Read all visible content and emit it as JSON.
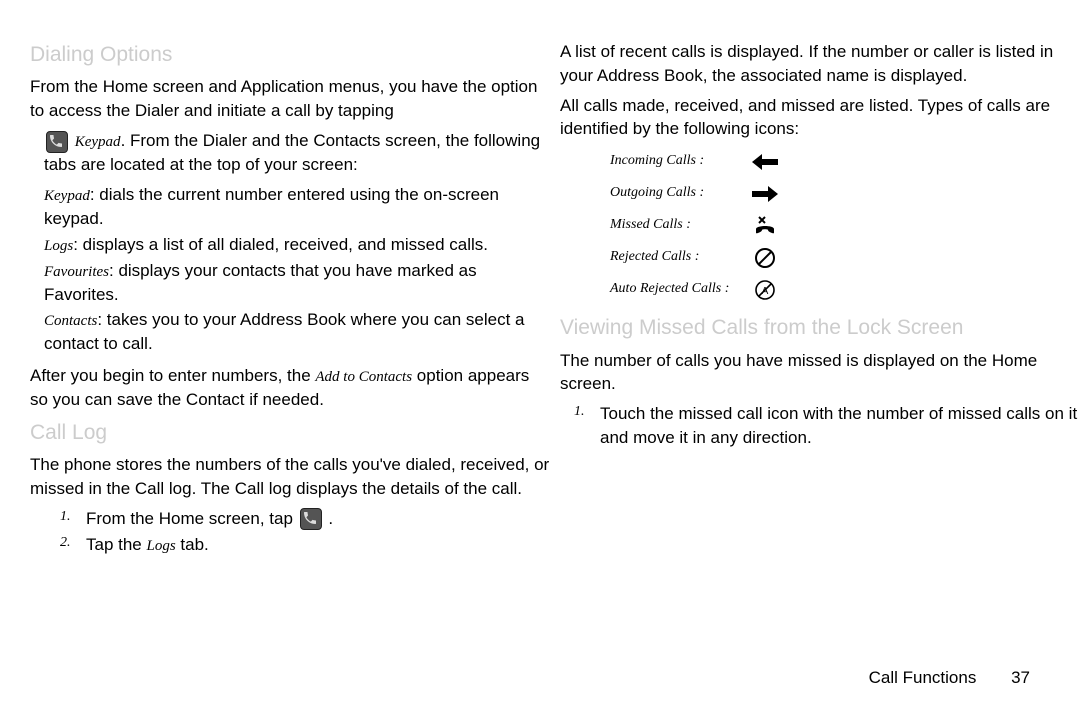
{
  "left": {
    "h1": "Dialing Options",
    "p1": "From the Home screen and Application menus, you have the option to access the Dialer and initiate a call by tapping",
    "p1b_a": "Keypad",
    "p1b_b": ". From the Dialer and the Contacts screen, the following tabs are located at the top of your screen:",
    "tabs": {
      "keypad_label": "Keypad",
      "keypad_desc": ": dials the current number entered using the on-screen keypad.",
      "logs_label": "Logs",
      "logs_desc": ": displays a list of all dialed, received, and missed calls.",
      "fav_label": "Favourites",
      "fav_desc": ": displays your contacts that you have marked as Favorites.",
      "contacts_label": "Contacts",
      "contacts_desc": ": takes you to your Address Book where you can select a contact to call."
    },
    "p2a": "After you begin to enter numbers, the ",
    "p2a_opt": "Add to Contacts",
    "p2b": " option appears so you can save the Contact if needed.",
    "h2": "Call Log",
    "p3": "The phone stores the numbers of the calls you've dialed, received, or missed in the Call log. The Call log displays the details of the call.",
    "steps": {
      "s1_num": "1.",
      "s1a": "From the Home screen, tap ",
      "s1b": ".",
      "s2_num": "2.",
      "s2a": "Tap the ",
      "s2_logs": "Logs",
      "s2b": " tab."
    }
  },
  "right": {
    "p1": "A list of recent calls is displayed. If the number or caller is listed in your Address Book, the associated name is displayed.",
    "p2": "All calls made, received, and missed are listed. Types of calls are identified by the following icons:",
    "icons": {
      "incoming": "Incoming Calls :",
      "outgoing": "Outgoing Calls :",
      "missed": "Missed Calls :",
      "rejected": "Rejected Calls :",
      "autorej": "Auto Rejected Calls :"
    },
    "h3": "Viewing Missed Calls from the Lock Screen",
    "p3": "The number of calls you have missed is displayed on the Home screen.",
    "step1_num": "1.",
    "step1": "Touch the missed call icon with the number of missed calls on it and move it in any direction."
  },
  "footer": {
    "section": "Call Functions",
    "page": "37"
  }
}
